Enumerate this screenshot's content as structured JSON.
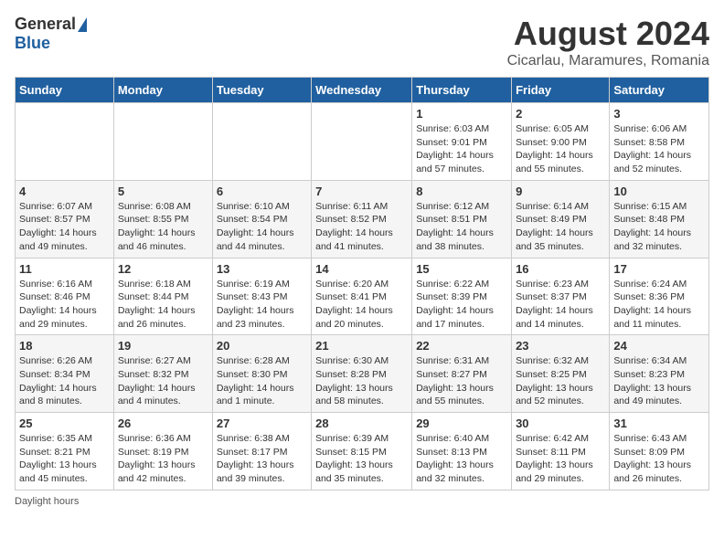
{
  "logo": {
    "general": "General",
    "blue": "Blue"
  },
  "title": "August 2024",
  "subtitle": "Cicarlau, Maramures, Romania",
  "days_of_week": [
    "Sunday",
    "Monday",
    "Tuesday",
    "Wednesday",
    "Thursday",
    "Friday",
    "Saturday"
  ],
  "weeks": [
    [
      {
        "day": "",
        "content": ""
      },
      {
        "day": "",
        "content": ""
      },
      {
        "day": "",
        "content": ""
      },
      {
        "day": "",
        "content": ""
      },
      {
        "day": "1",
        "content": "Sunrise: 6:03 AM\nSunset: 9:01 PM\nDaylight: 14 hours and 57 minutes."
      },
      {
        "day": "2",
        "content": "Sunrise: 6:05 AM\nSunset: 9:00 PM\nDaylight: 14 hours and 55 minutes."
      },
      {
        "day": "3",
        "content": "Sunrise: 6:06 AM\nSunset: 8:58 PM\nDaylight: 14 hours and 52 minutes."
      }
    ],
    [
      {
        "day": "4",
        "content": "Sunrise: 6:07 AM\nSunset: 8:57 PM\nDaylight: 14 hours and 49 minutes."
      },
      {
        "day": "5",
        "content": "Sunrise: 6:08 AM\nSunset: 8:55 PM\nDaylight: 14 hours and 46 minutes."
      },
      {
        "day": "6",
        "content": "Sunrise: 6:10 AM\nSunset: 8:54 PM\nDaylight: 14 hours and 44 minutes."
      },
      {
        "day": "7",
        "content": "Sunrise: 6:11 AM\nSunset: 8:52 PM\nDaylight: 14 hours and 41 minutes."
      },
      {
        "day": "8",
        "content": "Sunrise: 6:12 AM\nSunset: 8:51 PM\nDaylight: 14 hours and 38 minutes."
      },
      {
        "day": "9",
        "content": "Sunrise: 6:14 AM\nSunset: 8:49 PM\nDaylight: 14 hours and 35 minutes."
      },
      {
        "day": "10",
        "content": "Sunrise: 6:15 AM\nSunset: 8:48 PM\nDaylight: 14 hours and 32 minutes."
      }
    ],
    [
      {
        "day": "11",
        "content": "Sunrise: 6:16 AM\nSunset: 8:46 PM\nDaylight: 14 hours and 29 minutes."
      },
      {
        "day": "12",
        "content": "Sunrise: 6:18 AM\nSunset: 8:44 PM\nDaylight: 14 hours and 26 minutes."
      },
      {
        "day": "13",
        "content": "Sunrise: 6:19 AM\nSunset: 8:43 PM\nDaylight: 14 hours and 23 minutes."
      },
      {
        "day": "14",
        "content": "Sunrise: 6:20 AM\nSunset: 8:41 PM\nDaylight: 14 hours and 20 minutes."
      },
      {
        "day": "15",
        "content": "Sunrise: 6:22 AM\nSunset: 8:39 PM\nDaylight: 14 hours and 17 minutes."
      },
      {
        "day": "16",
        "content": "Sunrise: 6:23 AM\nSunset: 8:37 PM\nDaylight: 14 hours and 14 minutes."
      },
      {
        "day": "17",
        "content": "Sunrise: 6:24 AM\nSunset: 8:36 PM\nDaylight: 14 hours and 11 minutes."
      }
    ],
    [
      {
        "day": "18",
        "content": "Sunrise: 6:26 AM\nSunset: 8:34 PM\nDaylight: 14 hours and 8 minutes."
      },
      {
        "day": "19",
        "content": "Sunrise: 6:27 AM\nSunset: 8:32 PM\nDaylight: 14 hours and 4 minutes."
      },
      {
        "day": "20",
        "content": "Sunrise: 6:28 AM\nSunset: 8:30 PM\nDaylight: 14 hours and 1 minute."
      },
      {
        "day": "21",
        "content": "Sunrise: 6:30 AM\nSunset: 8:28 PM\nDaylight: 13 hours and 58 minutes."
      },
      {
        "day": "22",
        "content": "Sunrise: 6:31 AM\nSunset: 8:27 PM\nDaylight: 13 hours and 55 minutes."
      },
      {
        "day": "23",
        "content": "Sunrise: 6:32 AM\nSunset: 8:25 PM\nDaylight: 13 hours and 52 minutes."
      },
      {
        "day": "24",
        "content": "Sunrise: 6:34 AM\nSunset: 8:23 PM\nDaylight: 13 hours and 49 minutes."
      }
    ],
    [
      {
        "day": "25",
        "content": "Sunrise: 6:35 AM\nSunset: 8:21 PM\nDaylight: 13 hours and 45 minutes."
      },
      {
        "day": "26",
        "content": "Sunrise: 6:36 AM\nSunset: 8:19 PM\nDaylight: 13 hours and 42 minutes."
      },
      {
        "day": "27",
        "content": "Sunrise: 6:38 AM\nSunset: 8:17 PM\nDaylight: 13 hours and 39 minutes."
      },
      {
        "day": "28",
        "content": "Sunrise: 6:39 AM\nSunset: 8:15 PM\nDaylight: 13 hours and 35 minutes."
      },
      {
        "day": "29",
        "content": "Sunrise: 6:40 AM\nSunset: 8:13 PM\nDaylight: 13 hours and 32 minutes."
      },
      {
        "day": "30",
        "content": "Sunrise: 6:42 AM\nSunset: 8:11 PM\nDaylight: 13 hours and 29 minutes."
      },
      {
        "day": "31",
        "content": "Sunrise: 6:43 AM\nSunset: 8:09 PM\nDaylight: 13 hours and 26 minutes."
      }
    ]
  ],
  "footer": "Daylight hours"
}
